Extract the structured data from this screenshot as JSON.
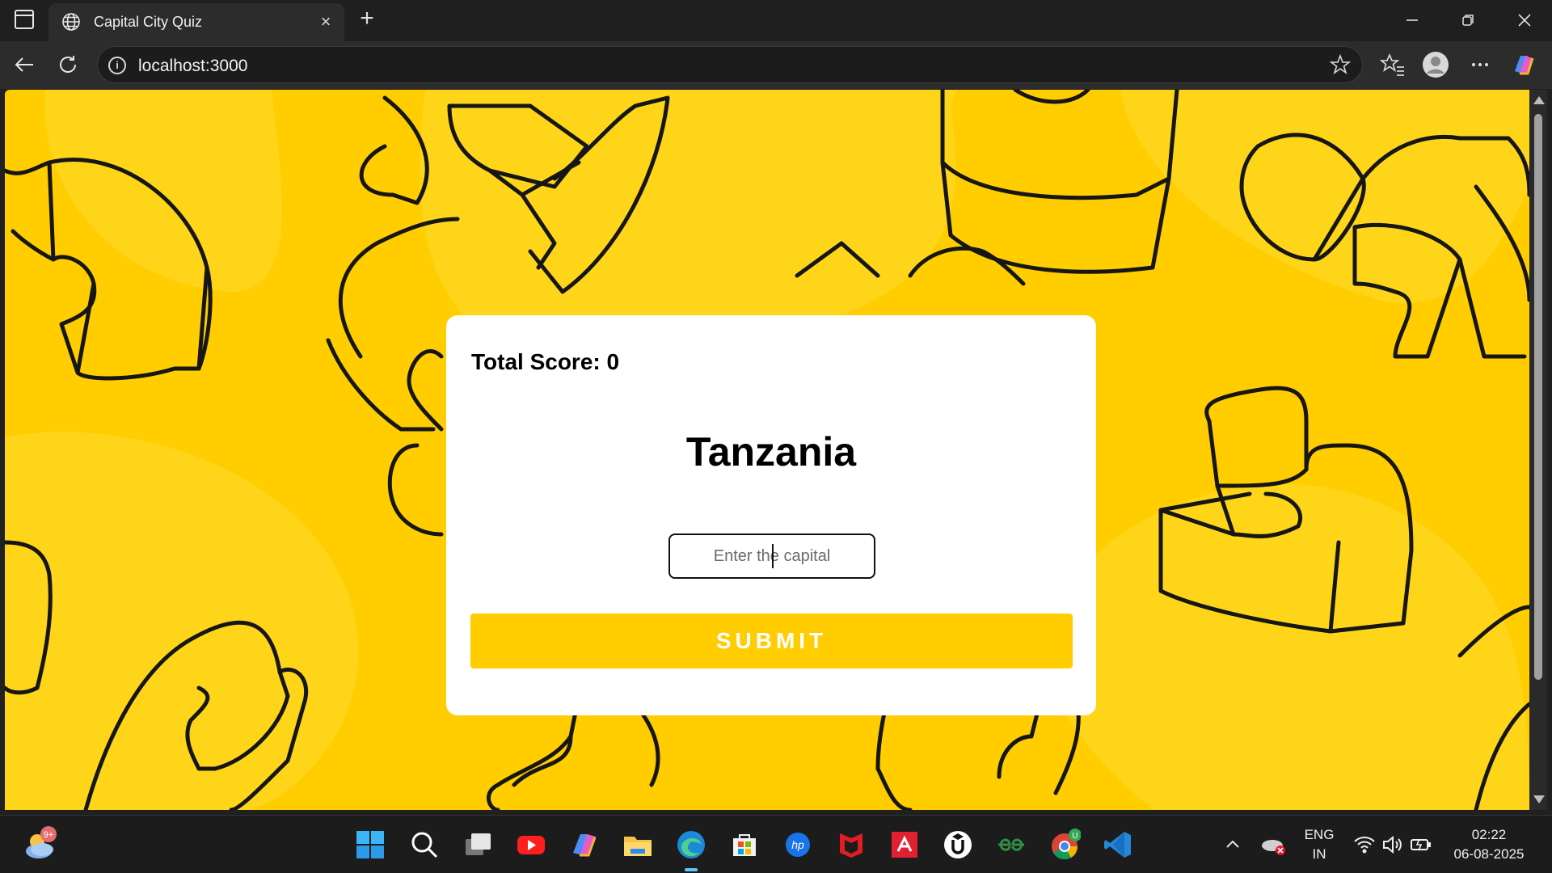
{
  "browser": {
    "tab_title": "Capital City Quiz",
    "url": "localhost:3000",
    "new_tab_symbol": "+",
    "close_tab_symbol": "×",
    "icons": [
      "sidebar-icon",
      "globe-icon",
      "back-icon",
      "refresh-icon",
      "info-icon",
      "star-icon",
      "favorites-icon",
      "profile-icon",
      "more-icon",
      "copilot-icon",
      "minimize-icon",
      "restore-icon",
      "close-icon"
    ]
  },
  "quiz": {
    "score_label": "Total Score: ",
    "score_value": "0",
    "country": "Tanzania",
    "answer_placeholder": "Enter the capital",
    "answer_value": "",
    "submit_label": "SUBMIT"
  },
  "colors": {
    "background": "#ffcd00",
    "card": "#ffffff",
    "button": "#ffcd00",
    "button_text": "#ffffff"
  },
  "taskbar": {
    "weather_badge": "9+",
    "apps": [
      "start-icon",
      "search-icon",
      "task-view-icon",
      "youtube-icon",
      "copilot-icon",
      "file-explorer-icon",
      "edge-icon",
      "microsoft-store-icon",
      "hp-icon",
      "mcafee-icon",
      "amd-icon",
      "udemy-icon",
      "geeksforgeeks-icon",
      "chrome-icon",
      "vscode-icon"
    ],
    "chrome_badge": "U",
    "language_top": "ENG",
    "language_bottom": "IN",
    "time": "02:22",
    "date": "06-08-2025"
  }
}
